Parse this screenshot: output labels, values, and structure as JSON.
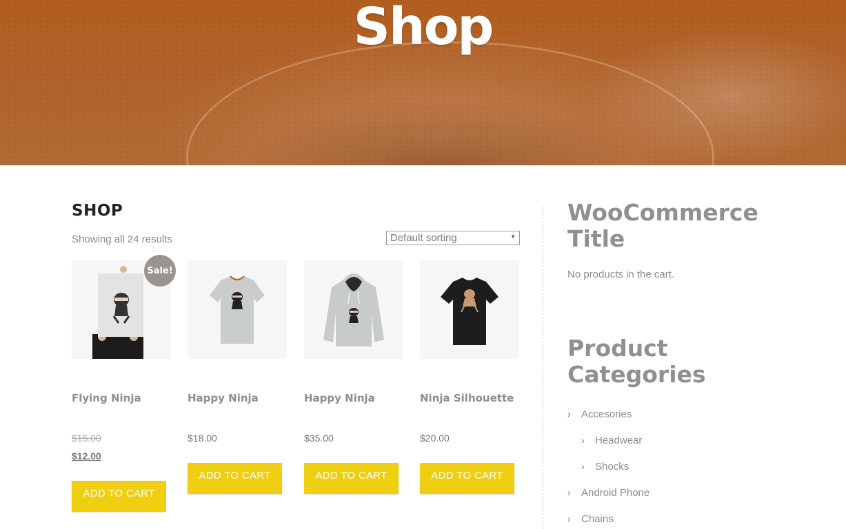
{
  "hero": {
    "title": "Shop"
  },
  "main": {
    "heading": "SHOP",
    "result_count": "Showing all 24 results",
    "sort": {
      "selected": "Default sorting"
    },
    "products": [
      {
        "name": "Flying Ninja",
        "old_price": "$15.00",
        "price": "$12.00",
        "sale_label": "Sale!",
        "button": "ADD TO CART"
      },
      {
        "name": "Happy Ninja",
        "price": "$18.00",
        "button": "ADD TO CART"
      },
      {
        "name": "Happy Ninja",
        "price": "$35.00",
        "button": "ADD TO CART"
      },
      {
        "name": "Ninja Silhouette",
        "price": "$20.00",
        "button": "ADD TO CART"
      }
    ]
  },
  "sidebar": {
    "cart_widget": {
      "title": "WooCommerce Title",
      "empty_text": "No products in the cart."
    },
    "categories_widget": {
      "title": "Product Categories",
      "items": [
        {
          "label": "Accesories",
          "level": 0
        },
        {
          "label": "Headwear",
          "level": 1
        },
        {
          "label": "Shocks",
          "level": 1
        },
        {
          "label": "Android Phone",
          "level": 0
        },
        {
          "label": "Chains",
          "level": 0
        }
      ]
    }
  },
  "colors": {
    "accent": "#f0cf12",
    "hero": "#b35e20",
    "sale_badge": "#9b938e"
  },
  "icons": [
    "chevron-right-icon",
    "dropdown-arrow-icon"
  ]
}
